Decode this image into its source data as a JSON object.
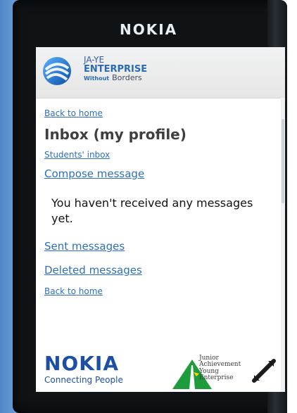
{
  "device": {
    "brand": "NOKIA"
  },
  "site_header": {
    "line1": "JA-YE",
    "line2": "ENTERPRISE",
    "tiny": "Without",
    "line3": "Borders"
  },
  "links": {
    "back_to_home_top": "Back to home",
    "students_inbox": "Students' inbox",
    "compose_message": "Compose message",
    "sent_messages": "Sent messages",
    "deleted_messages": "Deleted messages",
    "back_to_home_bottom": "Back to home"
  },
  "page": {
    "title": "Inbox (my profile)",
    "empty_state": "You haven't received any messages yet."
  },
  "footer": {
    "nokia_main": "NOKIA",
    "nokia_tagline": "Connecting People",
    "ja_text_lines": [
      "Junior",
      "Achievement",
      "Young",
      "Enterprise"
    ]
  },
  "colors": {
    "link": "#2d6fc1",
    "title": "#3f3f3f",
    "nokia_blue": "#1d4fa3"
  },
  "icons": {
    "header_logo": "ja-ye-globe-icon",
    "resize": "diagonal-arrows-icon"
  }
}
